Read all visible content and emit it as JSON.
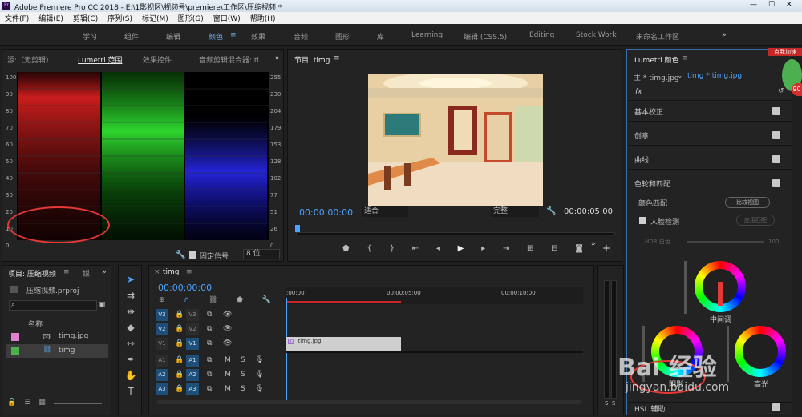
{
  "window": {
    "title": "Adobe Premiere Pro CC 2018 - E:\\1影视区\\视频号\\premiere\\工作区\\压缩视频 *"
  },
  "menu": [
    "文件(F)",
    "编辑(E)",
    "剪辑(C)",
    "序列(S)",
    "标记(M)",
    "图形(G)",
    "窗口(W)",
    "帮助(H)"
  ],
  "workspaces": [
    "学习",
    "组件",
    "编辑",
    "颜色",
    "效果",
    "音频",
    "图形",
    "库",
    "Learning",
    "编辑 (CSS.5)",
    "Editing",
    "Stock Work",
    "未命名工作区"
  ],
  "source_panel": {
    "tabs": [
      "源:（无剪辑）",
      "Lumetri 范围",
      "效果控件",
      "音频剪辑混合器: tl"
    ],
    "left_ticks": [
      "100",
      "90",
      "80",
      "70",
      "60",
      "50",
      "40",
      "30",
      "20",
      "10",
      "0"
    ],
    "right_ticks": [
      "255",
      "230",
      "204",
      "179",
      "153",
      "128",
      "102",
      "77",
      "51",
      "26",
      "0"
    ],
    "clamp_label": "固定信号",
    "bits": "8 位"
  },
  "program": {
    "title": "节目: timg",
    "timecode": "00:00:00:00",
    "fit": "适合",
    "quality": "完整",
    "duration": "00:00:05:00"
  },
  "project": {
    "title": "项目: 压缩视频",
    "tab2": "媒",
    "file": "压缩视频.prproj",
    "search_placeholder": "",
    "col_name": "名称",
    "items": [
      {
        "name": "timg.jpg",
        "color": "#e37fcf"
      },
      {
        "name": "timg",
        "color": "#4caf50"
      }
    ]
  },
  "timeline": {
    "tab": "timg",
    "timecode": "00:00:00:00",
    "ruler": [
      ":00:00",
      "00:00:05:00",
      "00:00:10:00"
    ],
    "video_tracks": [
      "V3",
      "V2",
      "V1"
    ],
    "audio_tracks": [
      "A1",
      "A2",
      "A3"
    ],
    "clip": "timg.jpg",
    "meter_labels": [
      "S",
      "S"
    ]
  },
  "lumetri": {
    "title": "Lumetri 颜色",
    "master": "主 * timg.jpg",
    "clip": "timg * timg.jpg",
    "fx": "fx",
    "sections": [
      "基本校正",
      "创意",
      "曲线",
      "色轮和匹配"
    ],
    "color_match": "颜色匹配",
    "compare_view": "比较视图",
    "face_detect": "人脸检测",
    "apply_match": "应用匹配",
    "hdr": "HDR 白色",
    "hdr_value": "100",
    "midtones": "中间调",
    "shadows": "阴影",
    "highlights": "高光",
    "hsl": "HSL 辅助"
  },
  "watermark": {
    "brand": "Bai 经验",
    "url": "jingyan.baidu.com"
  },
  "badge": {
    "text": "点我加速",
    "value": "90"
  }
}
